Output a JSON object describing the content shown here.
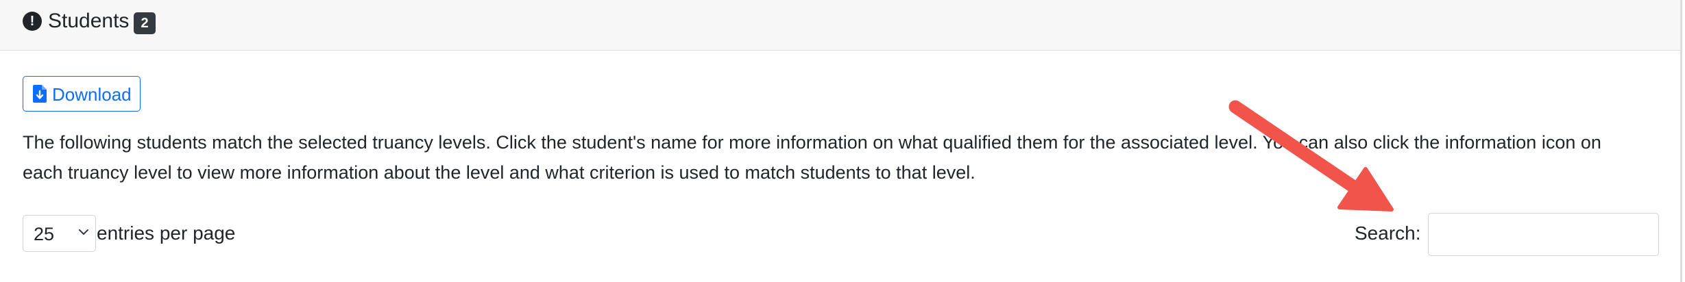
{
  "header": {
    "icon": "exclamation-circle-icon",
    "title": "Students",
    "badge_count": "2"
  },
  "download_button": {
    "icon": "file-download-icon",
    "label": "Download"
  },
  "description": "The following students match the selected truancy levels. Click the student's name for more information on what qualified them for the associated level. You can also click the information icon on each truancy level to view more information about the level and what criterion is used to match students to that level.",
  "entries": {
    "selected": "25",
    "label": "entries per page"
  },
  "search": {
    "label": "Search:",
    "value": "",
    "placeholder": ""
  },
  "annotation": {
    "icon": "red-arrow-icon",
    "color": "#f0544a"
  },
  "colors": {
    "primary": "#0d6efd",
    "header_bg": "#f7f7f7",
    "badge_bg": "#343a40",
    "text": "#212529"
  }
}
